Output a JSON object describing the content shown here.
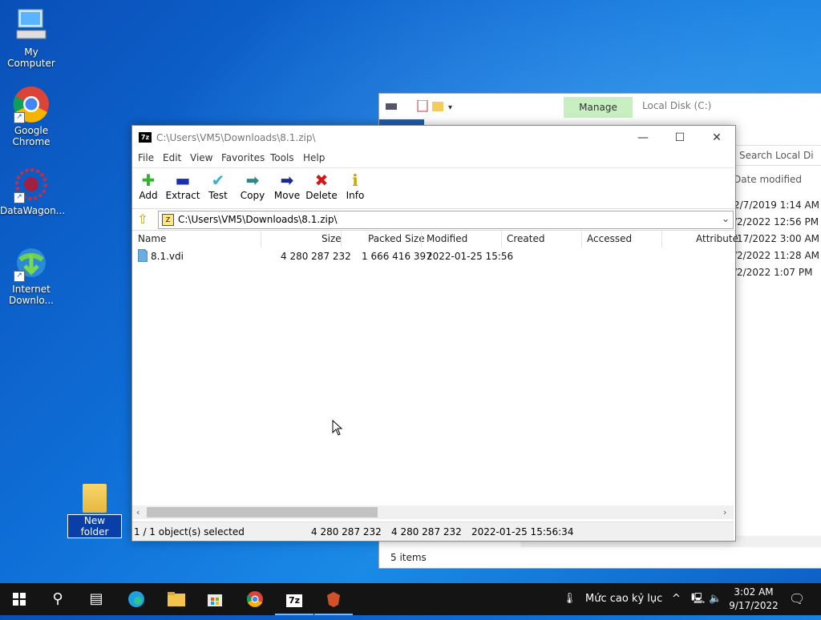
{
  "desktop": {
    "icons": [
      {
        "label": "My Computer"
      },
      {
        "label": "Google Chrome"
      },
      {
        "label": "DataWagon..."
      },
      {
        "label": "Internet Downlo..."
      }
    ],
    "new_folder_label": "New folder"
  },
  "explorer": {
    "manage_tab": "Manage",
    "location": "Local Disk (C:)",
    "search_placeholder": "Search Local Di",
    "column_modified": "Date modified",
    "dates": [
      "2/7/2019 1:14 AM",
      "/2/2022 12:56 PM",
      "/17/2022 3:00 AM",
      "/2/2022 11:28 AM",
      "/2/2022 1:07 PM"
    ],
    "status": "5 items"
  },
  "sevenzip": {
    "title": "C:\\Users\\VM5\\Downloads\\8.1.zip\\",
    "logo": "7z",
    "menu": [
      "File",
      "Edit",
      "View",
      "Favorites",
      "Tools",
      "Help"
    ],
    "toolbar": [
      {
        "label": "Add",
        "icon": "plus-icon",
        "color": "#2fb52f"
      },
      {
        "label": "Extract",
        "icon": "minus-icon",
        "color": "#1b2fb5"
      },
      {
        "label": "Test",
        "icon": "check-icon",
        "color": "#3bb0c8"
      },
      {
        "label": "Copy",
        "icon": "copy-arrow-icon",
        "color": "#2a8a8a"
      },
      {
        "label": "Move",
        "icon": "move-arrow-icon",
        "color": "#1a2a9a"
      },
      {
        "label": "Delete",
        "icon": "x-icon",
        "color": "#d01818"
      },
      {
        "label": "Info",
        "icon": "info-icon",
        "color": "#c8a800"
      }
    ],
    "address": "C:\\Users\\VM5\\Downloads\\8.1.zip\\",
    "columns": [
      "Name",
      "Size",
      "Packed Size",
      "Modified",
      "Created",
      "Accessed",
      "Attribute"
    ],
    "rows": [
      {
        "name": "8.1.vdi",
        "size": "4 280 287 232",
        "packed": "1 666 416 397",
        "modified": "2022-01-25 15:56"
      }
    ],
    "status": {
      "selected": "1 / 1 object(s) selected",
      "size": "4 280 287 232",
      "packed": "4 280 287 232",
      "modified": "2022-01-25 15:56:34"
    }
  },
  "taskbar": {
    "weather_text": "Mức cao kỷ lục",
    "time": "3:02 AM",
    "date": "9/17/2022",
    "zip_label": "7z"
  }
}
